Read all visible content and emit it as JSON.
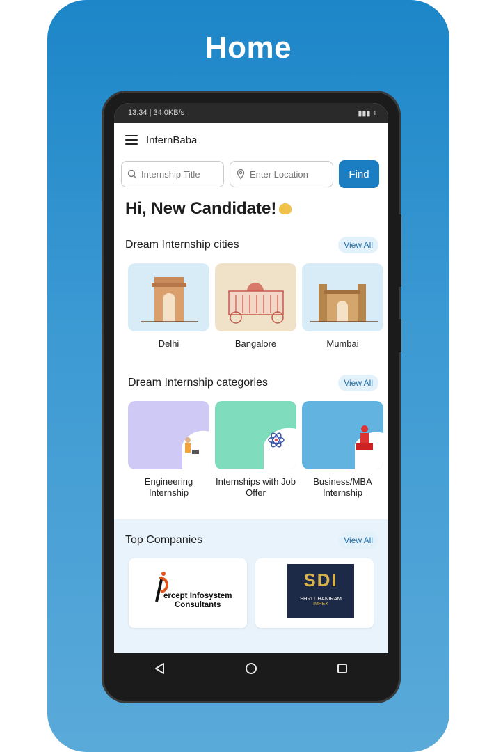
{
  "page_heading": "Home",
  "status_bar": {
    "left": "13:34 | 34.0KB/s",
    "right": "▮▮▮ +"
  },
  "app": {
    "title": "InternBaba"
  },
  "search": {
    "title_placeholder": "Internship Title",
    "location_placeholder": "Enter Location",
    "find_label": "Find"
  },
  "greeting": "Hi, New Candidate!",
  "cities": {
    "title": "Dream Internship cities",
    "view_all": "View All",
    "items": [
      {
        "label": "Delhi",
        "bg": "#d8ecf8"
      },
      {
        "label": "Bangalore",
        "bg": "#efe2c9"
      },
      {
        "label": "Mumbai",
        "bg": "#d8ecf8"
      }
    ]
  },
  "categories": {
    "title": "Dream Internship categories",
    "view_all": "View All",
    "items": [
      {
        "label": "Engineering Internship",
        "bg": "#cfc9f5"
      },
      {
        "label": "Internships with Job Offer",
        "bg": "#7fdcbc"
      },
      {
        "label": "Business/MBA Internship",
        "bg": "#62b3e0"
      }
    ]
  },
  "companies": {
    "title": "Top Companies",
    "view_all": "View All",
    "items": [
      {
        "name_line1": "ercept Infosystem",
        "name_line2": "Consultants"
      },
      {
        "logo_text": "SDI",
        "name_line1": "SHRI DHANIRAM",
        "name_line2": "IMPEX"
      }
    ]
  },
  "colors": {
    "accent": "#1b7ec2",
    "card_bg": "#2d8fcd"
  },
  "icons": [
    "menu-icon",
    "search-icon",
    "location-pin-icon",
    "clap-icon",
    "back-icon",
    "home-icon",
    "recents-icon"
  ]
}
